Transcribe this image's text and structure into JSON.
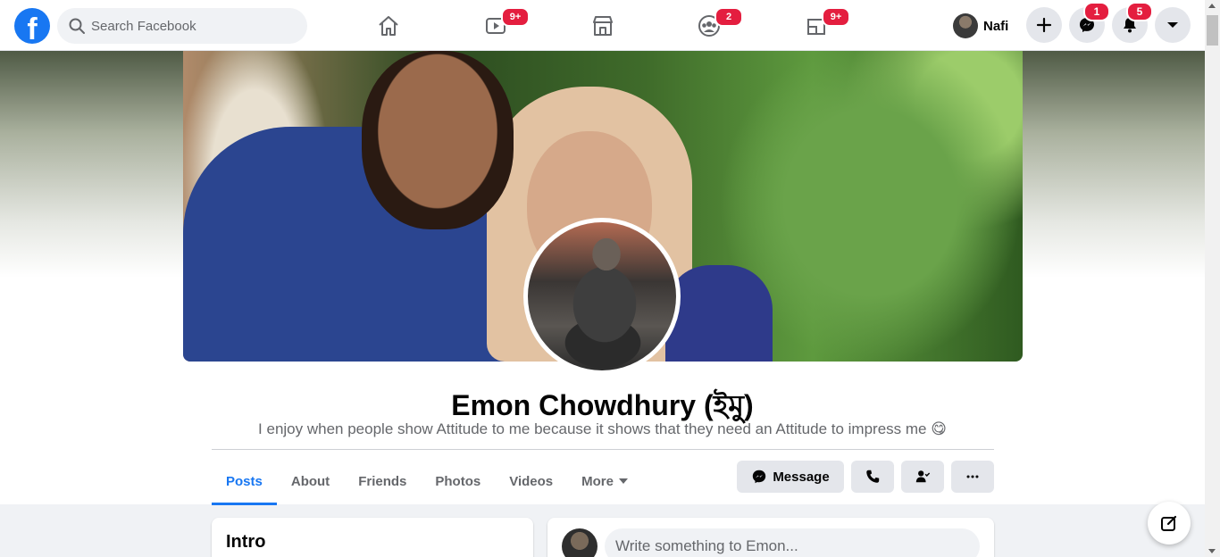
{
  "topbar": {
    "logo_letter": "f",
    "search": {
      "placeholder": "Search Facebook"
    },
    "nav": [
      {
        "name": "home",
        "icon": "home-icon",
        "badge": ""
      },
      {
        "name": "watch",
        "icon": "video-icon",
        "badge": "9+"
      },
      {
        "name": "marketplace",
        "icon": "store-icon",
        "badge": ""
      },
      {
        "name": "groups",
        "icon": "groups-icon",
        "badge": "2"
      },
      {
        "name": "gaming",
        "icon": "gaming-icon",
        "badge": "9+"
      }
    ],
    "profile_name": "Nafi",
    "create_icon": "plus-icon",
    "messenger_badge": "1",
    "notifications_badge": "5",
    "menu_icon": "chevron-down-icon"
  },
  "profile": {
    "name": "Emon Chowdhury (ইমু)",
    "bio": "I enjoy when people show Attitude to me because it shows that they need an Attitude to impress me 😋"
  },
  "tabs": [
    {
      "label": "Posts",
      "active": true
    },
    {
      "label": "About",
      "active": false
    },
    {
      "label": "Friends",
      "active": false
    },
    {
      "label": "Photos",
      "active": false
    },
    {
      "label": "Videos",
      "active": false
    },
    {
      "label": "More",
      "active": false
    }
  ],
  "actions": {
    "message_label": "Message"
  },
  "intro": {
    "title": "Intro"
  },
  "composer": {
    "placeholder": "Write something to Emon..."
  },
  "colors": {
    "brand": "#1877f2",
    "badge": "#e41e3f",
    "bg": "#f0f2f5"
  }
}
